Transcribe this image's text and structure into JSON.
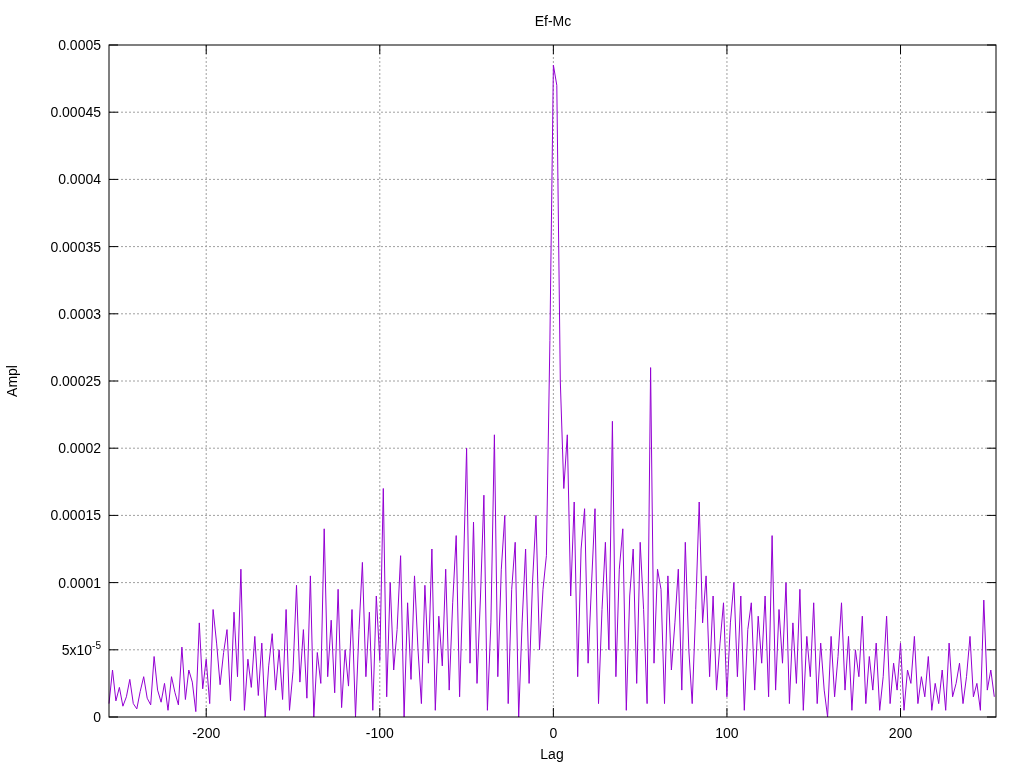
{
  "chart_data": {
    "type": "line",
    "title": "Ef-Mc",
    "xlabel": "Lag",
    "ylabel": "Ampl",
    "grid": true,
    "xlim": [
      -256,
      255
    ],
    "ylim": [
      0,
      0.0005
    ],
    "xticks": [
      -200,
      -100,
      0,
      100,
      200
    ],
    "yticks": [
      0,
      {
        "value": 5e-05,
        "label": "5x10$^{-5}$"
      },
      0.0001,
      0.00015,
      0.0002,
      0.00025,
      0.0003,
      0.00035,
      0.0004,
      0.00045,
      0.0005
    ],
    "x": [
      -256,
      -254,
      -252,
      -250,
      -248,
      -246,
      -244,
      -242,
      -240,
      -238,
      -236,
      -234,
      -232,
      -230,
      -228,
      -226,
      -224,
      -222,
      -220,
      -218,
      -216,
      -214,
      -212,
      -210,
      -208,
      -206,
      -204,
      -202,
      -200,
      -198,
      -196,
      -194,
      -192,
      -190,
      -188,
      -186,
      -184,
      -182,
      -180,
      -178,
      -176,
      -174,
      -172,
      -170,
      -168,
      -166,
      -164,
      -162,
      -160,
      -158,
      -156,
      -154,
      -152,
      -150,
      -148,
      -146,
      -144,
      -142,
      -140,
      -138,
      -136,
      -134,
      -132,
      -130,
      -128,
      -126,
      -124,
      -122,
      -120,
      -118,
      -116,
      -114,
      -112,
      -110,
      -108,
      -106,
      -104,
      -102,
      -100,
      -98,
      -96,
      -94,
      -92,
      -90,
      -88,
      -86,
      -84,
      -82,
      -80,
      -78,
      -76,
      -74,
      -72,
      -70,
      -68,
      -66,
      -64,
      -62,
      -60,
      -58,
      -56,
      -54,
      -52,
      -50,
      -48,
      -46,
      -44,
      -42,
      -40,
      -38,
      -36,
      -34,
      -32,
      -30,
      -28,
      -26,
      -24,
      -22,
      -20,
      -18,
      -16,
      -14,
      -12,
      -10,
      -8,
      -6,
      -4,
      -2,
      0,
      2,
      4,
      6,
      8,
      10,
      12,
      14,
      16,
      18,
      20,
      22,
      24,
      26,
      28,
      30,
      32,
      34,
      36,
      38,
      40,
      42,
      44,
      46,
      48,
      50,
      52,
      54,
      56,
      58,
      60,
      62,
      64,
      66,
      68,
      70,
      72,
      74,
      76,
      78,
      80,
      82,
      84,
      86,
      88,
      90,
      92,
      94,
      96,
      98,
      100,
      102,
      104,
      106,
      108,
      110,
      112,
      114,
      116,
      118,
      120,
      122,
      124,
      126,
      128,
      130,
      132,
      134,
      136,
      138,
      140,
      142,
      144,
      146,
      148,
      150,
      152,
      154,
      156,
      158,
      160,
      162,
      164,
      166,
      168,
      170,
      172,
      174,
      176,
      178,
      180,
      182,
      184,
      186,
      188,
      190,
      192,
      194,
      196,
      198,
      200,
      202,
      204,
      206,
      208,
      210,
      212,
      214,
      216,
      218,
      220,
      222,
      224,
      226,
      228,
      230,
      232,
      234,
      236,
      238,
      240,
      242,
      244,
      246,
      248,
      250,
      252,
      254
    ],
    "series": [
      {
        "color": "#9400d3",
        "values": [
          1e-05,
          3.5e-05,
          1.2e-05,
          2.2e-05,
          8e-06,
          1.5e-05,
          2.8e-05,
          1e-05,
          6e-06,
          1.9e-05,
          3e-05,
          1.4e-05,
          9e-06,
          4.5e-05,
          2e-05,
          1.1e-05,
          2.5e-05,
          5e-06,
          3e-05,
          1.8e-05,
          9e-06,
          5.2e-05,
          1.3e-05,
          3.5e-05,
          2.6e-05,
          4e-06,
          7e-05,
          2.1e-05,
          4.3e-05,
          1e-05,
          8e-05,
          5.5e-05,
          2.4e-05,
          4.8e-05,
          6.5e-05,
          1.2e-05,
          7.8e-05,
          3e-05,
          0.00011,
          5e-06,
          4.3e-05,
          2.2e-05,
          6e-05,
          1.6e-05,
          5.5e-05,
          0,
          3.8e-05,
          6.2e-05,
          2e-05,
          5e-05,
          1.3e-05,
          8e-05,
          5e-06,
          3.4e-05,
          9.8e-05,
          2.6e-05,
          6.5e-05,
          1.4e-05,
          0.000105,
          0,
          4.8e-05,
          2.5e-05,
          0.00014,
          3e-05,
          7.2e-05,
          1.8e-05,
          9.5e-05,
          7e-06,
          5e-05,
          2.3e-05,
          8e-05,
          0,
          6.5e-05,
          0.000115,
          3e-05,
          7.8e-05,
          5e-06,
          9e-05,
          4.2e-05,
          0.00017,
          1.5e-05,
          0.0001,
          3.5e-05,
          6.5e-05,
          0.00012,
          0,
          8.5e-05,
          2.8e-05,
          0.000105,
          5e-05,
          1e-05,
          9.8e-05,
          4e-05,
          0.000125,
          5e-06,
          7.5e-05,
          3.8e-05,
          0.00011,
          2e-05,
          8.5e-05,
          0.000135,
          1.5e-05,
          0.0001,
          0.0002,
          4e-05,
          0.000145,
          2.5e-05,
          9e-05,
          0.000165,
          5e-06,
          7e-05,
          0.00021,
          3e-05,
          0.00011,
          0.00015,
          1e-05,
          9.5e-05,
          0.00013,
          0,
          7e-05,
          0.000125,
          2.5e-05,
          0.0001,
          0.00015,
          5e-05,
          9.5e-05,
          0.00012,
          0.00028,
          0.000485,
          0.00047,
          0.00025,
          0.00017,
          0.00021,
          9e-05,
          0.00016,
          3e-05,
          0.000125,
          0.000155,
          4e-05,
          0.0001,
          0.000155,
          1e-05,
          8e-05,
          0.00013,
          5e-05,
          0.00022,
          3e-05,
          0.00011,
          0.00014,
          5e-06,
          9e-05,
          0.000125,
          2.5e-05,
          0.00013,
          8e-05,
          1e-05,
          0.00026,
          4e-05,
          0.00011,
          9.5e-05,
          1e-05,
          0.000105,
          3.5e-05,
          7e-05,
          0.00011,
          2e-05,
          0.00013,
          5e-05,
          1e-05,
          8e-05,
          0.00016,
          7e-05,
          0.000105,
          3e-05,
          9e-05,
          2e-05,
          5.5e-05,
          8.5e-05,
          1.5e-05,
          7e-05,
          0.0001,
          3e-05,
          9e-05,
          5e-06,
          6.5e-05,
          8.5e-05,
          2e-05,
          7.5e-05,
          4e-05,
          9e-05,
          1.5e-05,
          0.000135,
          2e-05,
          8e-05,
          4e-05,
          0.0001,
          1e-05,
          7e-05,
          2.5e-05,
          9.5e-05,
          5e-06,
          6e-05,
          3e-05,
          8.5e-05,
          1e-05,
          5.5e-05,
          2e-05,
          0,
          6e-05,
          1.5e-05,
          4.5e-05,
          8.5e-05,
          2e-05,
          6e-05,
          5e-06,
          5e-05,
          3e-05,
          7.5e-05,
          1e-05,
          4.5e-05,
          2e-05,
          5.5e-05,
          5e-06,
          3e-05,
          7.5e-05,
          1e-05,
          4e-05,
          2e-05,
          5.5e-05,
          5e-06,
          3.5e-05,
          2.5e-05,
          6e-05,
          1e-05,
          3e-05,
          1.5e-05,
          4.5e-05,
          5e-06,
          2.5e-05,
          1e-05,
          3.5e-05,
          5e-06,
          5.5e-05,
          1.5e-05,
          2.5e-05,
          4e-05,
          1e-05,
          3e-05,
          6e-05,
          1.5e-05,
          2.5e-05,
          5e-06,
          8.7e-05,
          2e-05,
          3.5e-05,
          1.5e-05
        ]
      }
    ]
  }
}
